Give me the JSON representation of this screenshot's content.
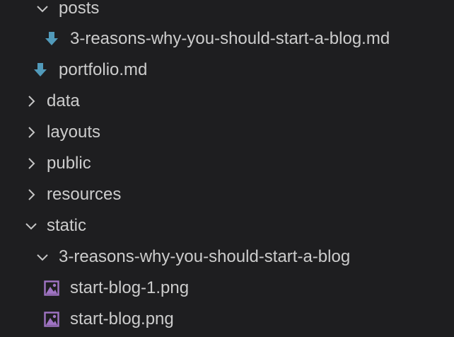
{
  "explorer": {
    "items": [
      {
        "label": "posts",
        "kind": "folder",
        "state": "expanded"
      },
      {
        "label": "3-reasons-why-you-should-start-a-blog.md",
        "kind": "file",
        "icon": "markdown-arrow-down-icon"
      },
      {
        "label": "portfolio.md",
        "kind": "file",
        "icon": "markdown-arrow-down-icon"
      },
      {
        "label": "data",
        "kind": "folder",
        "state": "collapsed"
      },
      {
        "label": "layouts",
        "kind": "folder",
        "state": "collapsed"
      },
      {
        "label": "public",
        "kind": "folder",
        "state": "collapsed"
      },
      {
        "label": "resources",
        "kind": "folder",
        "state": "collapsed"
      },
      {
        "label": "static",
        "kind": "folder",
        "state": "expanded"
      },
      {
        "label": "3-reasons-why-you-should-start-a-blog",
        "kind": "folder",
        "state": "expanded"
      },
      {
        "label": "start-blog-1.png",
        "kind": "file",
        "icon": "image-file-icon"
      },
      {
        "label": "start-blog.png",
        "kind": "file",
        "icon": "image-file-icon"
      }
    ]
  },
  "colors": {
    "background": "#1e1e20",
    "text": "#cccccc",
    "chevron": "#c5c5c5",
    "markdown_icon": "#519aba",
    "image_icon": "#a074c4"
  }
}
